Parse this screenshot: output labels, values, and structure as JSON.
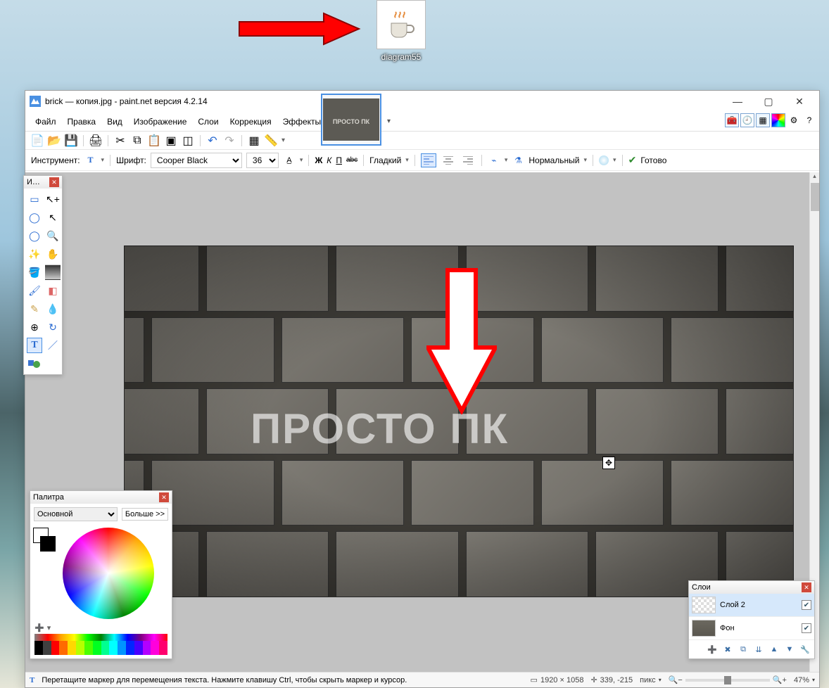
{
  "desktop_icon_label": "diagram55",
  "window": {
    "title": "brick — копия.jpg - paint.net версия 4.2.14",
    "min": "—",
    "max": "▢",
    "close": "✕"
  },
  "menu": {
    "file": "Файл",
    "edit": "Правка",
    "view": "Вид",
    "image": "Изображение",
    "layers": "Слои",
    "adjust": "Коррекция",
    "effects": "Эффекты"
  },
  "text_toolbar": {
    "instrument_label": "Инструмент:",
    "font_label": "Шрифт:",
    "font_value": "Cooper Black",
    "font_size": "36",
    "bold": "Ж",
    "italic": "К",
    "under": "П",
    "strike": "abc",
    "aa_label": "Гладкий",
    "blend_label": "Нормальный",
    "finish": "Готово"
  },
  "canvas_text": "ПРОСТО ПК",
  "tools_panel_title": "И…",
  "palette": {
    "title": "Палитра",
    "primary": "Основной",
    "more": "Больше >>"
  },
  "layers": {
    "title": "Слои",
    "layer2": "Слой 2",
    "background": "Фон"
  },
  "status": {
    "hint": "Перетащите маркер для перемещения текста. Нажмите клавишу Ctrl, чтобы скрыть маркер и курсор.",
    "dims": "1920 × 1058",
    "pos": "339, -215",
    "unit": "пикс",
    "zoom": "47%"
  }
}
